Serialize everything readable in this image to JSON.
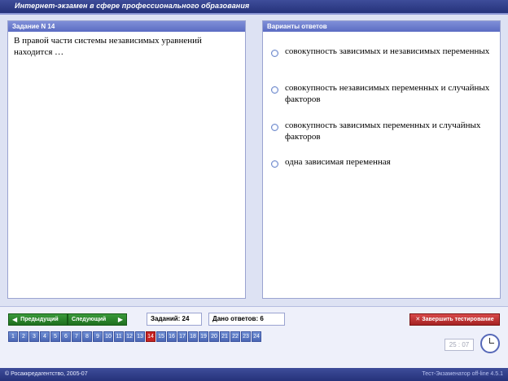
{
  "window": {
    "title": "Интернет-экзамен в сфере профессионального образования"
  },
  "question": {
    "header": "Задание N 14",
    "text": "В правой части системы независимых уравнений находится …"
  },
  "answers": {
    "header": "Варианты ответов",
    "options": [
      "совокупность зависимых и независимых переменных",
      "совокупность независимых переменных и случайных факторов",
      "совокупность зависимых переменных и случайных факторов",
      "одна зависимая переменная"
    ]
  },
  "nav": {
    "prev_label": "Предыдущий",
    "next_label": "Следующий",
    "tasks_label": "Заданий: 24",
    "answers_label": "Дано ответов: 6",
    "finish_label": "Завершить тестирование",
    "current_page": 14,
    "pages": [
      "1",
      "2",
      "3",
      "4",
      "5",
      "6",
      "7",
      "8",
      "9",
      "10",
      "11",
      "12",
      "13",
      "14",
      "15",
      "16",
      "17",
      "18",
      "19",
      "20",
      "21",
      "22",
      "23",
      "24"
    ]
  },
  "timer": {
    "value": "25 : 07"
  },
  "status": {
    "left": "© Росаккредагентство, 2005-07",
    "right": "Тест-Экзаменатор off-line 4.5.1"
  },
  "colors": {
    "title_bar": "#25327a",
    "panel_header": "#5b6cc3",
    "nav_button": "#1f6f1f",
    "finish_button": "#a52222",
    "current_page": "#c62424"
  }
}
